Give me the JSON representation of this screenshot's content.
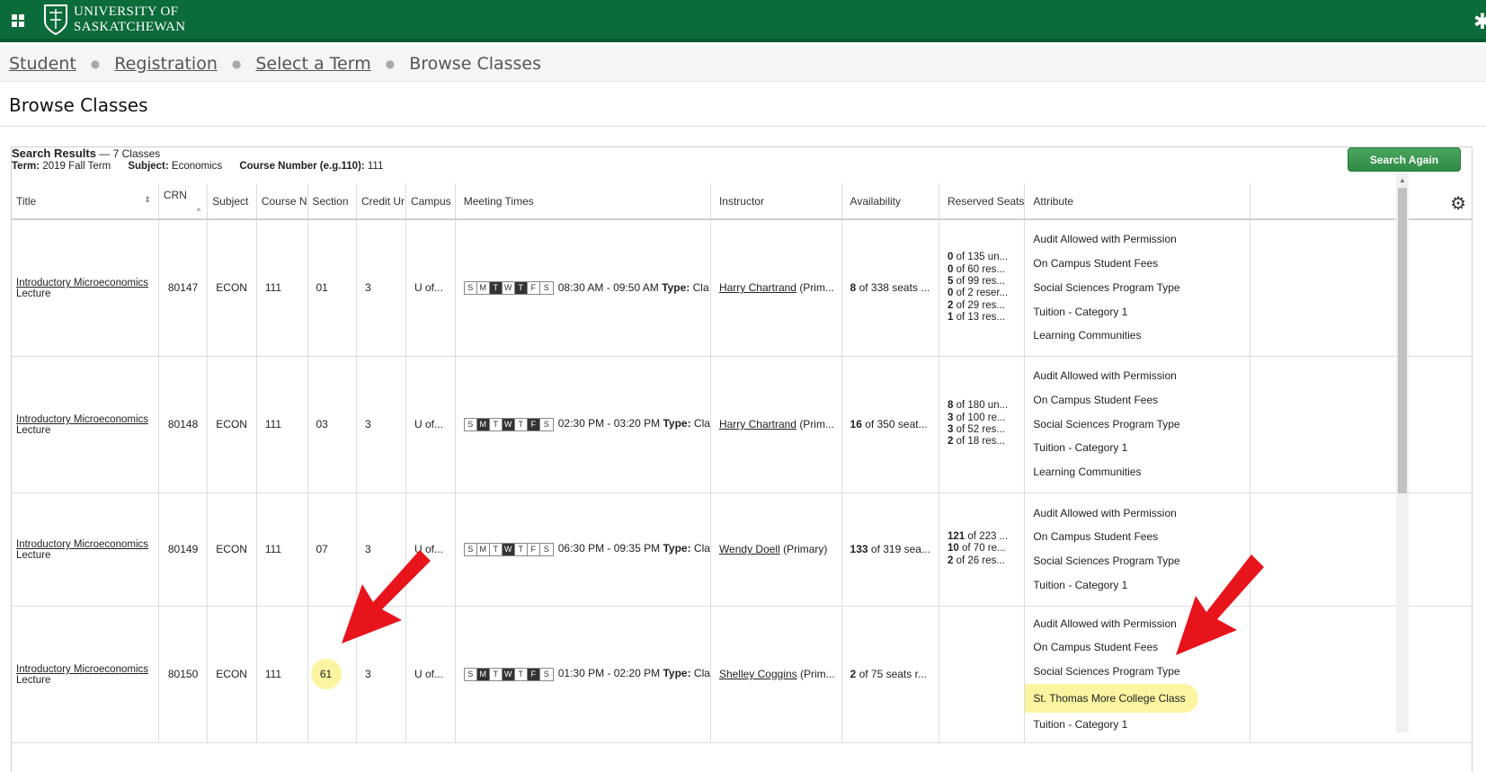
{
  "header": {
    "university_line1": "UNIVERSITY OF",
    "university_line2": "SASKATCHEWAN"
  },
  "breadcrumb": {
    "items": [
      "Student",
      "Registration",
      "Select a Term"
    ],
    "current": "Browse Classes"
  },
  "page_title": "Browse Classes",
  "search_results": {
    "label": "Search Results",
    "count": "— 7 Classes",
    "term_label": "Term:",
    "term_value": "2019 Fall Term",
    "subject_label": "Subject:",
    "subject_value": "Economics",
    "course_label": "Course Number (e.g.110):",
    "course_value": "111",
    "search_again": "Search Again"
  },
  "columns": [
    "Title",
    "CRN",
    "Subject",
    "Course N",
    "Section",
    "Credit Ur",
    "Campus",
    "Meeting Times",
    "Instructor",
    "Availability",
    "Reserved Seats",
    "Attribute"
  ],
  "rows": [
    {
      "title": "Introductory Microeconomics",
      "schedule": "Lecture",
      "crn": "80147",
      "subject": "ECON",
      "course": "111",
      "section": "01",
      "credits": "3",
      "campus": "U of...",
      "days": [
        "S",
        "M",
        "T",
        "W",
        "T",
        "F",
        "S"
      ],
      "days_on": [
        false,
        false,
        true,
        false,
        true,
        false,
        false
      ],
      "time": "08:30 AM - 09:50 AM",
      "type_label": "Type:",
      "type_value": "Cla",
      "instructor": "Harry Chartrand",
      "instructor_role": "(Prim...",
      "avail_num": "8",
      "avail_rest": "of 338 seats ...",
      "reserved": [
        [
          "0",
          "of 135 un..."
        ],
        [
          "0",
          "of 60 res..."
        ],
        [
          "5",
          "of 99 res..."
        ],
        [
          "0",
          "of 2 reser..."
        ],
        [
          "2",
          "of 29 res..."
        ],
        [
          "1",
          "of 13 res..."
        ]
      ],
      "attributes": [
        "Audit Allowed with Permission",
        "On Campus Student Fees",
        "Social Sciences Program Type",
        "Tuition - Category 1",
        "Learning Communities"
      ]
    },
    {
      "title": "Introductory Microeconomics",
      "schedule": "Lecture",
      "crn": "80148",
      "subject": "ECON",
      "course": "111",
      "section": "03",
      "credits": "3",
      "campus": "U of...",
      "days": [
        "S",
        "M",
        "T",
        "W",
        "T",
        "F",
        "S"
      ],
      "days_on": [
        false,
        true,
        false,
        true,
        false,
        true,
        false
      ],
      "time": "02:30 PM - 03:20 PM",
      "type_label": "Type:",
      "type_value": "Cla",
      "instructor": "Harry Chartrand",
      "instructor_role": "(Prim...",
      "avail_num": "16",
      "avail_rest": "of 350 seat...",
      "reserved": [
        [
          "8",
          "of 180 un..."
        ],
        [
          "3",
          "of 100 re..."
        ],
        [
          "3",
          "of 52 res..."
        ],
        [
          "2",
          "of 18 res..."
        ]
      ],
      "attributes": [
        "Audit Allowed with Permission",
        "On Campus Student Fees",
        "Social Sciences Program Type",
        "Tuition - Category 1",
        "Learning Communities"
      ]
    },
    {
      "title": "Introductory Microeconomics",
      "schedule": "Lecture",
      "crn": "80149",
      "subject": "ECON",
      "course": "111",
      "section": "07",
      "credits": "3",
      "campus": "U of...",
      "days": [
        "S",
        "M",
        "T",
        "W",
        "T",
        "F",
        "S"
      ],
      "days_on": [
        false,
        false,
        false,
        true,
        false,
        false,
        false
      ],
      "time": "06:30 PM - 09:35 PM",
      "type_label": "Type:",
      "type_value": "Cla",
      "instructor": "Wendy Doell",
      "instructor_role": "(Primary)",
      "avail_num": "133",
      "avail_rest": "of 319 sea...",
      "reserved": [
        [
          "121",
          "of 223 ..."
        ],
        [
          "10",
          "of 70 re..."
        ],
        [
          "2",
          "of 26 res..."
        ]
      ],
      "attributes": [
        "Audit Allowed with Permission",
        "On Campus Student Fees",
        "Social Sciences Program Type",
        "Tuition - Category 1"
      ]
    },
    {
      "title": "Introductory Microeconomics",
      "schedule": "Lecture",
      "crn": "80150",
      "subject": "ECON",
      "course": "111",
      "section": "61",
      "credits": "3",
      "campus": "U of...",
      "days": [
        "S",
        "M",
        "T",
        "W",
        "T",
        "F",
        "S"
      ],
      "days_on": [
        false,
        true,
        false,
        true,
        false,
        true,
        false
      ],
      "time": "01:30 PM - 02:20 PM",
      "type_label": "Type:",
      "type_value": "Cla",
      "instructor": "Shelley Coggins",
      "instructor_role": "(Prim...",
      "avail_num": "2",
      "avail_rest": "of 75 seats r...",
      "reserved": [],
      "attributes": [
        "Audit Allowed with Permission",
        "On Campus Student Fees",
        "Social Sciences Program Type",
        "St. Thomas More College Class",
        "Tuition - Category 1"
      ]
    }
  ],
  "colors": {
    "header_green": "#0c6b3a",
    "highlight": "#fbf5a1",
    "arrow_red": "#e8141c",
    "button_green": "#3a9850"
  },
  "icons": [
    "grid-icon",
    "university-shield-icon",
    "gear-icon",
    "sort-icon",
    "red-arrow-icon"
  ]
}
